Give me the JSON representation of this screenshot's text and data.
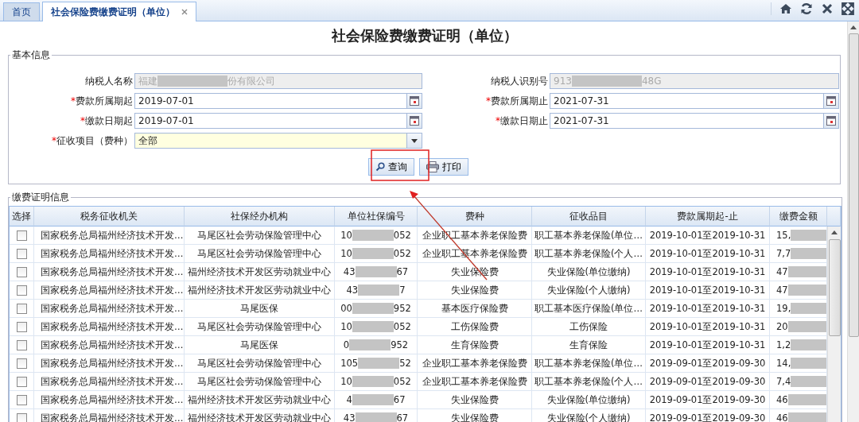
{
  "tabs": [
    {
      "label": "首页",
      "selected": false,
      "closable": false
    },
    {
      "label": "社会保险费缴费证明（单位）",
      "selected": true,
      "closable": true
    }
  ],
  "title": "社会保险费缴费证明（单位）",
  "basic_info": {
    "legend": "基本信息",
    "fields": [
      {
        "label": "纳税人名称",
        "required": false,
        "kind": "readonly",
        "value": "福建",
        "value_after": "份有限公司"
      },
      {
        "label": "纳税人识别号",
        "required": false,
        "kind": "readonly",
        "value": "913",
        "value_after": "48G"
      },
      {
        "label": "费款所属期起",
        "required": true,
        "kind": "date",
        "value": "2019-07-01"
      },
      {
        "label": "费款所属期止",
        "required": true,
        "kind": "date",
        "value": "2021-07-31"
      },
      {
        "label": "缴款日期起",
        "required": true,
        "kind": "date",
        "value": "2019-07-01"
      },
      {
        "label": "缴款日期止",
        "required": true,
        "kind": "date",
        "value": "2021-07-31"
      },
      {
        "label": "征收项目（费种）",
        "required": true,
        "kind": "select",
        "value": "全部"
      }
    ],
    "required_mark": "*",
    "buttons": [
      {
        "label": "查询",
        "kind": "search"
      },
      {
        "label": "打印",
        "kind": "print"
      }
    ]
  },
  "payment_info": {
    "legend": "缴费证明信息",
    "checkbox_header": "选择",
    "columns": [
      "税务征收机关",
      "社保经办机构",
      "单位社保编号",
      "费种",
      "征收品目",
      "费款属期起-止",
      "缴费金额"
    ],
    "rows": [
      {
        "checked": false,
        "cells": [
          "国家税务总局福州经济技术开发…",
          "马尾区社会劳动保险管理中心",
          {
            "before": "10",
            "after": "052"
          },
          "企业职工基本养老保险费",
          "职工基本养老保险(单位…",
          "2019-10-01至2019-10-31",
          {
            "before": "15,"
          }
        ]
      },
      {
        "checked": false,
        "cells": [
          "国家税务总局福州经济技术开发…",
          "马尾区社会劳动保险管理中心",
          {
            "before": "10",
            "after": "052"
          },
          "企业职工基本养老保险费",
          "职工基本养老保险(个人…",
          "2019-10-01至2019-10-31",
          {
            "before": "7,7"
          }
        ]
      },
      {
        "checked": false,
        "cells": [
          "国家税务总局福州经济技术开发…",
          "福州经济技术开发区劳动就业中心",
          {
            "before": "43",
            "after": "67"
          },
          "失业保险费",
          "失业保险(单位缴纳)",
          "2019-10-01至2019-10-31",
          {
            "before": "47"
          }
        ]
      },
      {
        "checked": false,
        "cells": [
          "国家税务总局福州经济技术开发…",
          "福州经济技术开发区劳动就业中心",
          {
            "before": "43",
            "after": "7"
          },
          "失业保险费",
          "失业保险(个人缴纳)",
          "2019-10-01至2019-10-31",
          {
            "before": "47"
          }
        ]
      },
      {
        "checked": false,
        "cells": [
          "国家税务总局福州经济技术开发…",
          "马尾医保",
          {
            "before": "00",
            "after": "952"
          },
          "基本医疗保险费",
          "职工基本医疗保险(单位…",
          "2019-10-01至2019-10-31",
          {
            "before": "19,"
          }
        ]
      },
      {
        "checked": false,
        "cells": [
          "国家税务总局福州经济技术开发…",
          "马尾区社会劳动保险管理中心",
          {
            "before": "10",
            "after": "052"
          },
          "工伤保险费",
          "工伤保险",
          "2019-10-01至2019-10-31",
          {
            "before": "20"
          }
        ]
      },
      {
        "checked": false,
        "cells": [
          "国家税务总局福州经济技术开发…",
          "马尾医保",
          {
            "before": "0",
            "after": "952"
          },
          "生育保险费",
          "生育保险",
          "2019-10-01至2019-10-31",
          {
            "before": "1,2"
          }
        ]
      },
      {
        "checked": false,
        "cells": [
          "国家税务总局福州经济技术开发…",
          "马尾区社会劳动保险管理中心",
          {
            "before": "105",
            "after": "52"
          },
          "企业职工基本养老保险费",
          "职工基本养老保险(单位…",
          "2019-09-01至2019-09-30",
          {
            "before": "14,"
          }
        ]
      },
      {
        "checked": false,
        "cells": [
          "国家税务总局福州经济技术开发…",
          "马尾区社会劳动保险管理中心",
          {
            "before": "10",
            "after": "052"
          },
          "企业职工基本养老保险费",
          "职工基本养老保险(个人…",
          "2019-09-01至2019-09-30",
          {
            "before": "7,4"
          }
        ]
      },
      {
        "checked": false,
        "cells": [
          "国家税务总局福州经济技术开发…",
          "福州经济技术开发区劳动就业中心",
          {
            "before": "4",
            "after": "67"
          },
          "失业保险费",
          "失业保险(单位缴纳)",
          "2019-09-01至2019-09-30",
          {
            "before": "46"
          }
        ]
      },
      {
        "checked": false,
        "cells": [
          "国家税务总局福州经济技术开发…",
          "福州经济技术开发区劳动就业中心",
          {
            "before": "43",
            "after": "67"
          },
          "失业保险费",
          "失业保险(个人缴纳)",
          "2019-09-01至2019-09-30",
          {
            "before": "46"
          }
        ]
      }
    ]
  },
  "annotation": {
    "kind": "box-and-arrow"
  }
}
